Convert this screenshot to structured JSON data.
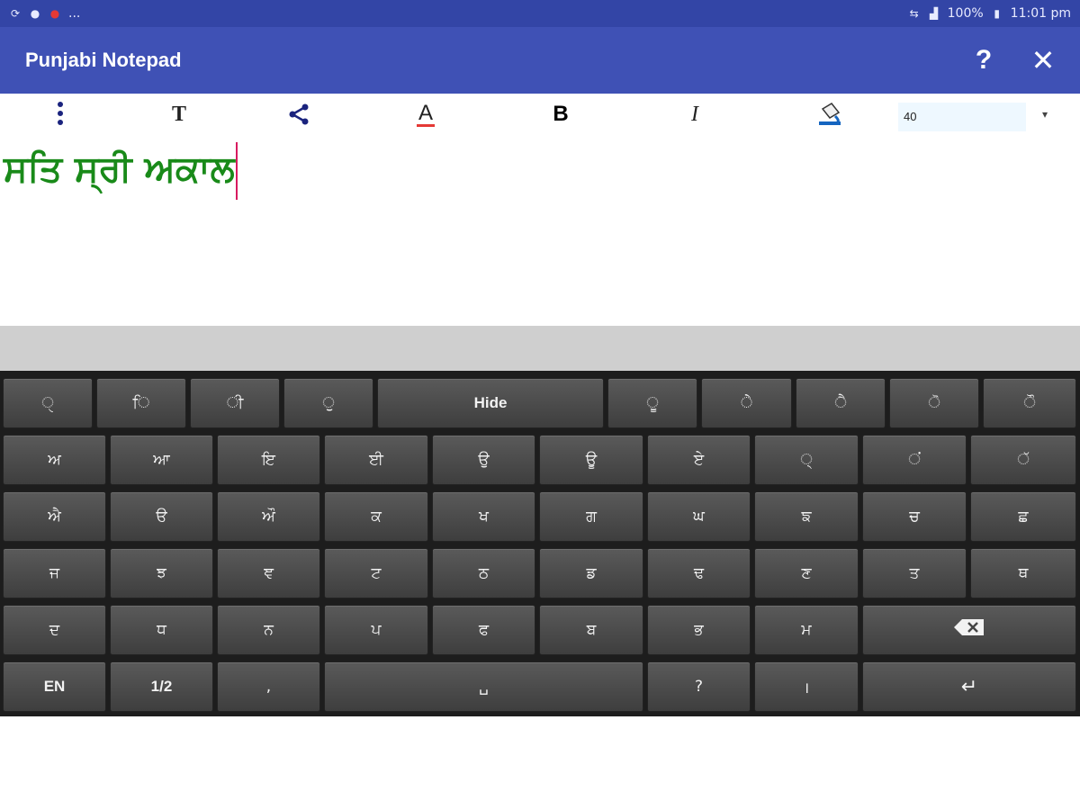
{
  "status_bar": {
    "battery": "100%",
    "time": "11:01 pm",
    "overflow": "..."
  },
  "app_bar": {
    "title": "Punjabi Notepad",
    "help_label": "?",
    "close_label": "✕"
  },
  "toolbar": {
    "menu_icon": "more-vert-icon",
    "font_label": "T",
    "bold_label": "B",
    "italic_label": "I",
    "text_color_label": "A",
    "font_size": "40",
    "font_size_arrow": "▾"
  },
  "editor": {
    "text": "ਸਤਿ ਸ੍ਰੀ ਅਕਾਲ",
    "text_color": "#198a19"
  },
  "keyboard": {
    "rows": [
      [
        "ੑ",
        "ਿ",
        "ੀ",
        "ੁ",
        "Hide",
        "ੂ",
        "ੇ",
        "ੈ",
        "ੋ",
        "ੌ"
      ],
      [
        "ਅ",
        "ਆ",
        "ਇ",
        "ਈ",
        "ਉ",
        "ਊ",
        "ਏ",
        "੍",
        "ਂ",
        "ੱ"
      ],
      [
        "ਐ",
        "ੳ",
        "ਔ",
        "ਕ",
        "ਖ",
        "ਗ",
        "ਘ",
        "ਙ",
        "ਚ",
        "ਛ"
      ],
      [
        "ਜ",
        "ਝ",
        "ਞ",
        "ਟ",
        "ਠ",
        "ਡ",
        "ਢ",
        "ਣ",
        "ਤ",
        "ਥ"
      ],
      [
        "ਦ",
        "ਧ",
        "ਨ",
        "ਪ",
        "ਫ",
        "ਬ",
        "ਭ",
        "ਮ",
        "⌫"
      ],
      [
        "EN",
        "1/2",
        ",",
        "␣",
        "?",
        "।",
        "↵"
      ]
    ]
  }
}
